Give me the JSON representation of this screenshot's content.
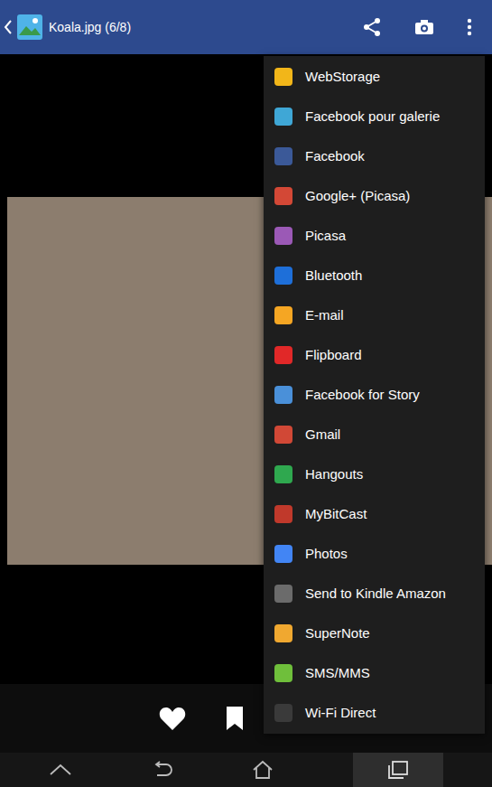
{
  "window": {
    "title": "Koala.jpg (6/8)"
  },
  "share_menu": {
    "items": [
      {
        "label": "WebStorage",
        "color": "#f2b619"
      },
      {
        "label": "Facebook pour galerie",
        "color": "#3fa7d6"
      },
      {
        "label": "Facebook",
        "color": "#3b5998"
      },
      {
        "label": "Google+ (Picasa)",
        "color": "#d34836"
      },
      {
        "label": "Picasa",
        "color": "#9b59b6"
      },
      {
        "label": "Bluetooth",
        "color": "#1e6fd9"
      },
      {
        "label": "E-mail",
        "color": "#f5a623"
      },
      {
        "label": "Flipboard",
        "color": "#e12828"
      },
      {
        "label": "Facebook for Story",
        "color": "#4a90d9"
      },
      {
        "label": "Gmail",
        "color": "#d14836"
      },
      {
        "label": "Hangouts",
        "color": "#2fa84f"
      },
      {
        "label": "MyBitCast",
        "color": "#c0392b"
      },
      {
        "label": "Photos",
        "color": "#4285f4"
      },
      {
        "label": "Send to Kindle Amazon",
        "color": "#6b6b6b"
      },
      {
        "label": "SuperNote",
        "color": "#f0a830"
      },
      {
        "label": "SMS/MMS",
        "color": "#6fbf3b"
      },
      {
        "label": "Wi-Fi Direct",
        "color": "#3a3a3a"
      }
    ]
  }
}
